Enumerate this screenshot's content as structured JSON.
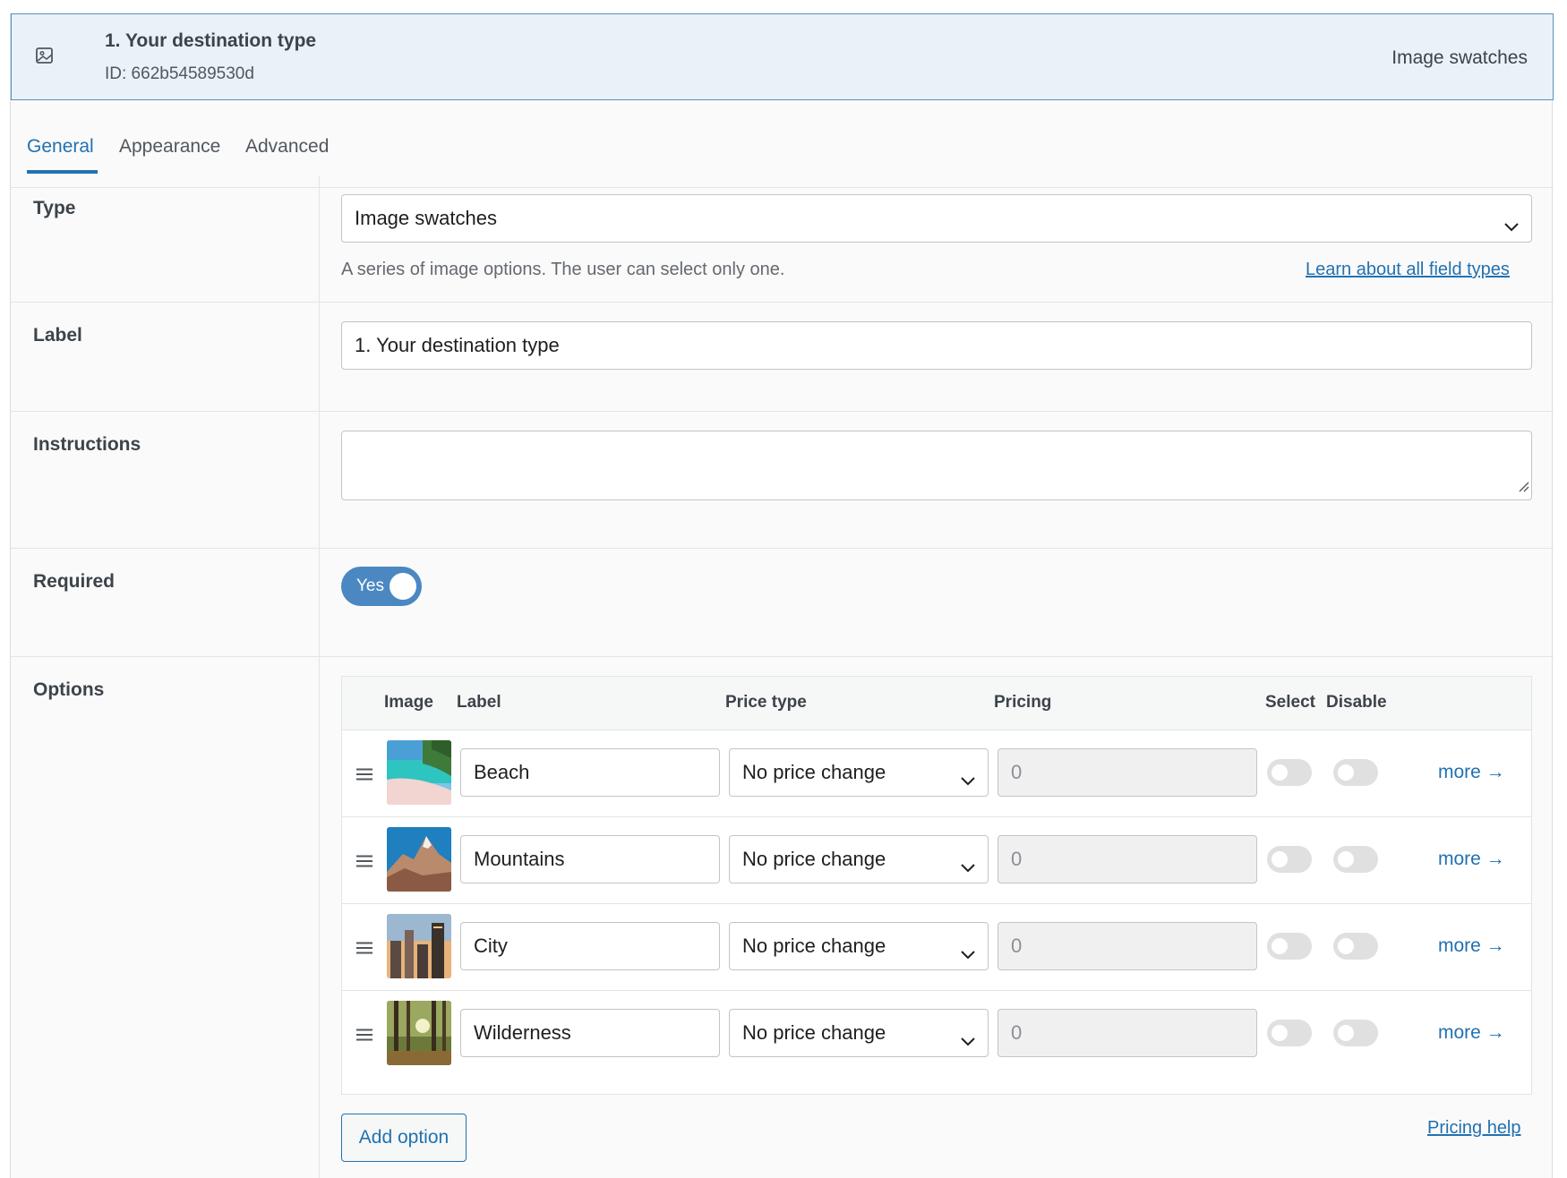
{
  "header": {
    "title": "1. Your destination type",
    "id_text": "ID: 662b54589530d",
    "type_text": "Image swatches",
    "icon": "image-icon"
  },
  "tabs": [
    {
      "label": "General",
      "active": true
    },
    {
      "label": "Appearance",
      "active": false
    },
    {
      "label": "Advanced",
      "active": false
    }
  ],
  "type_field": {
    "label": "Type",
    "value": "Image swatches",
    "description": "A series of image options. The user can select only one.",
    "help_link": "Learn about all field types"
  },
  "label_field": {
    "label": "Label",
    "value": "1. Your destination type"
  },
  "instructions_field": {
    "label": "Instructions",
    "value": ""
  },
  "required_field": {
    "label": "Required",
    "toggle_text": "Yes",
    "on": true
  },
  "options": {
    "label": "Options",
    "columns": [
      "Image",
      "Label",
      "Price type",
      "Pricing",
      "Select",
      "Disable"
    ],
    "rows": [
      {
        "label": "Beach",
        "price_type": "No price change",
        "pricing": "0",
        "more": "more →",
        "image": "beach"
      },
      {
        "label": "Mountains",
        "price_type": "No price change",
        "pricing": "0",
        "more": "more →",
        "image": "mountains"
      },
      {
        "label": "City",
        "price_type": "No price change",
        "pricing": "0",
        "more": "more →",
        "image": "city"
      },
      {
        "label": "Wilderness",
        "price_type": "No price change",
        "pricing": "0",
        "more": "more →",
        "image": "wilderness"
      }
    ],
    "add_button": "Add option",
    "pricing_help": "Pricing help"
  },
  "colors": {
    "accent": "#2271b1",
    "toggle_on": "#4b88c2",
    "header_bg": "#e9f2f9"
  }
}
